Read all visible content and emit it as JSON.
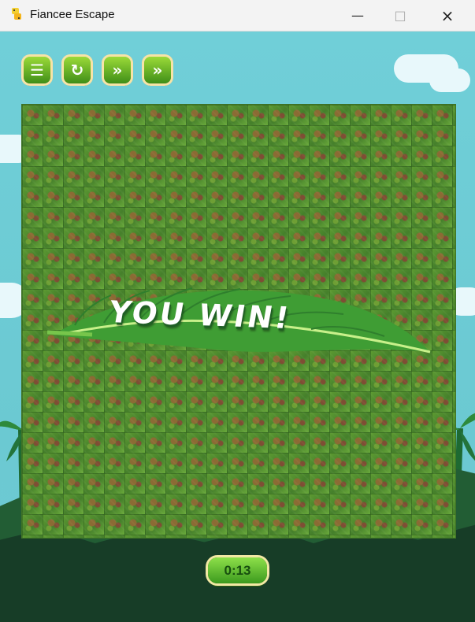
{
  "window": {
    "title": "Fiancee Escape",
    "controls": [
      "minimize",
      "maximize",
      "close"
    ]
  },
  "toolbar": {
    "buttons": [
      {
        "name": "menu",
        "icon": "list-icon"
      },
      {
        "name": "restart",
        "icon": "restart-icon"
      },
      {
        "name": "skip",
        "icon": "fast-forward-icon"
      },
      {
        "name": "fast",
        "icon": "next-icon"
      }
    ]
  },
  "game": {
    "message": "YOU WIN!",
    "timer": "0:13"
  },
  "colors": {
    "sky": "#63c9d3",
    "board_green": "#4f8b2e",
    "button_green": "#3f8e18",
    "message_white": "#ffffff"
  }
}
